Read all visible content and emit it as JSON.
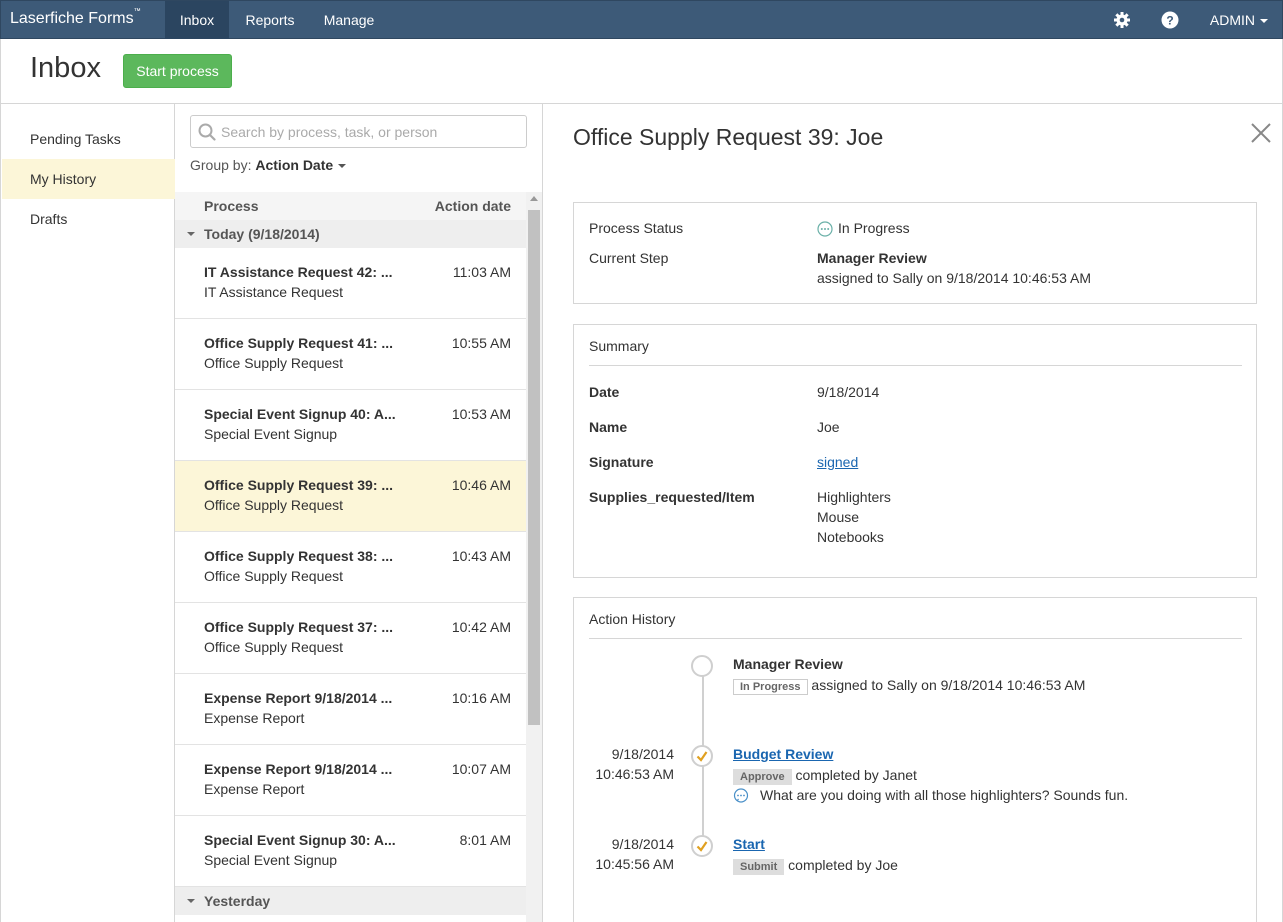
{
  "nav": {
    "brand": "Laserfiche Forms",
    "brand_mark": "™",
    "items": [
      {
        "label": "Inbox",
        "active": true
      },
      {
        "label": "Reports",
        "active": false
      },
      {
        "label": "Manage",
        "active": false
      }
    ],
    "user": "ADMIN",
    "icons": [
      "gear-icon",
      "help-icon"
    ]
  },
  "header": {
    "title": "Inbox",
    "start_button": "Start process",
    "accent": "#5cb85c"
  },
  "sidebar": {
    "items": [
      {
        "label": "Pending Tasks",
        "selected": false
      },
      {
        "label": "My History",
        "selected": true
      },
      {
        "label": "Drafts",
        "selected": false
      }
    ]
  },
  "list": {
    "search_placeholder": "Search by process, task, or person",
    "group_by_label": "Group by:",
    "group_by_value": "Action Date",
    "columns": {
      "process": "Process",
      "action_date": "Action date"
    },
    "groups": [
      {
        "label": "Today (9/18/2014)",
        "rows": [
          {
            "title": "IT Assistance Request 42: ...",
            "subtitle": "IT Assistance Request",
            "time": "11:03 AM",
            "selected": false
          },
          {
            "title": "Office Supply Request 41: ...",
            "subtitle": "Office Supply Request",
            "time": "10:55 AM",
            "selected": false
          },
          {
            "title": "Special Event Signup 40: A...",
            "subtitle": "Special Event Signup",
            "time": "10:53 AM",
            "selected": false
          },
          {
            "title": "Office Supply Request 39: ...",
            "subtitle": "Office Supply Request",
            "time": "10:46 AM",
            "selected": true
          },
          {
            "title": "Office Supply Request 38: ...",
            "subtitle": "Office Supply Request",
            "time": "10:43 AM",
            "selected": false
          },
          {
            "title": "Office Supply Request 37: ...",
            "subtitle": "Office Supply Request",
            "time": "10:42 AM",
            "selected": false
          },
          {
            "title": "Expense Report 9/18/2014 ...",
            "subtitle": "Expense Report",
            "time": "10:16 AM",
            "selected": false
          },
          {
            "title": "Expense Report 9/18/2014 ...",
            "subtitle": "Expense Report",
            "time": "10:07 AM",
            "selected": false
          },
          {
            "title": "Special Event Signup 30: A...",
            "subtitle": "Special Event Signup",
            "time": "8:01 AM",
            "selected": false
          }
        ]
      },
      {
        "label": "Yesterday",
        "rows": []
      }
    ]
  },
  "detail": {
    "title": "Office Supply Request 39: Joe",
    "status": {
      "process_status_label": "Process Status",
      "process_status_value": "In Progress",
      "current_step_label": "Current Step",
      "current_step_value": "Manager Review",
      "current_step_detail": "assigned to Sally on 9/18/2014 10:46:53 AM"
    },
    "summary": {
      "heading": "Summary",
      "fields": [
        {
          "label": "Date",
          "value": "9/18/2014"
        },
        {
          "label": "Name",
          "value": "Joe"
        },
        {
          "label": "Signature",
          "value": "signed"
        },
        {
          "label": "Supplies_requested/Item",
          "value": [
            "Highlighters",
            "Mouse",
            "Notebooks"
          ]
        }
      ]
    },
    "history": {
      "heading": "Action History",
      "steps": [
        {
          "date": "",
          "time": "",
          "step": "Manager Review",
          "tag": "In Progress",
          "text": "assigned to Sally on 9/18/2014 10:46:53 AM",
          "comment": "",
          "done": false
        },
        {
          "date": "9/18/2014",
          "time": "10:46:53 AM",
          "step": "Budget Review",
          "tag": "Approve",
          "text": "completed by Janet",
          "comment": "What are you doing with all those highlighters? Sounds fun.",
          "done": true
        },
        {
          "date": "9/18/2014",
          "time": "10:45:56 AM",
          "step": "Start",
          "tag": "Submit",
          "text": "completed by Joe",
          "comment": "",
          "done": true
        }
      ]
    }
  }
}
